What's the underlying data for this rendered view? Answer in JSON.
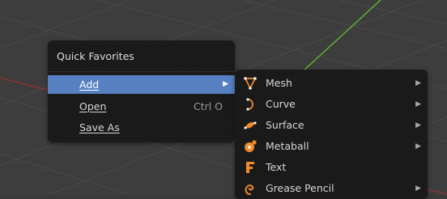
{
  "colors": {
    "menu_bg": "#181818",
    "highlight": "#5680c2",
    "icon_orange": "#f08a28",
    "axis_green": "#5fb033",
    "axis_red": "#a43a3a"
  },
  "quick_favorites": {
    "title": "Quick Favorites",
    "items": [
      {
        "label": "Add",
        "shortcut": "",
        "has_submenu": true,
        "active": true
      },
      {
        "label": "Open",
        "shortcut": "Ctrl O",
        "has_submenu": false,
        "active": false
      },
      {
        "label": "Save As",
        "shortcut": "",
        "has_submenu": false,
        "active": false
      }
    ]
  },
  "add_menu": {
    "items": [
      {
        "label": "Mesh",
        "icon": "mesh-icon",
        "has_submenu": true
      },
      {
        "label": "Curve",
        "icon": "curve-icon",
        "has_submenu": true
      },
      {
        "label": "Surface",
        "icon": "surface-icon",
        "has_submenu": true
      },
      {
        "label": "Metaball",
        "icon": "metaball-icon",
        "has_submenu": true
      },
      {
        "label": "Text",
        "icon": "text-icon",
        "has_submenu": false
      },
      {
        "label": "Grease Pencil",
        "icon": "grease-pencil-icon",
        "has_submenu": true
      }
    ]
  },
  "arrow_glyph": "▶"
}
